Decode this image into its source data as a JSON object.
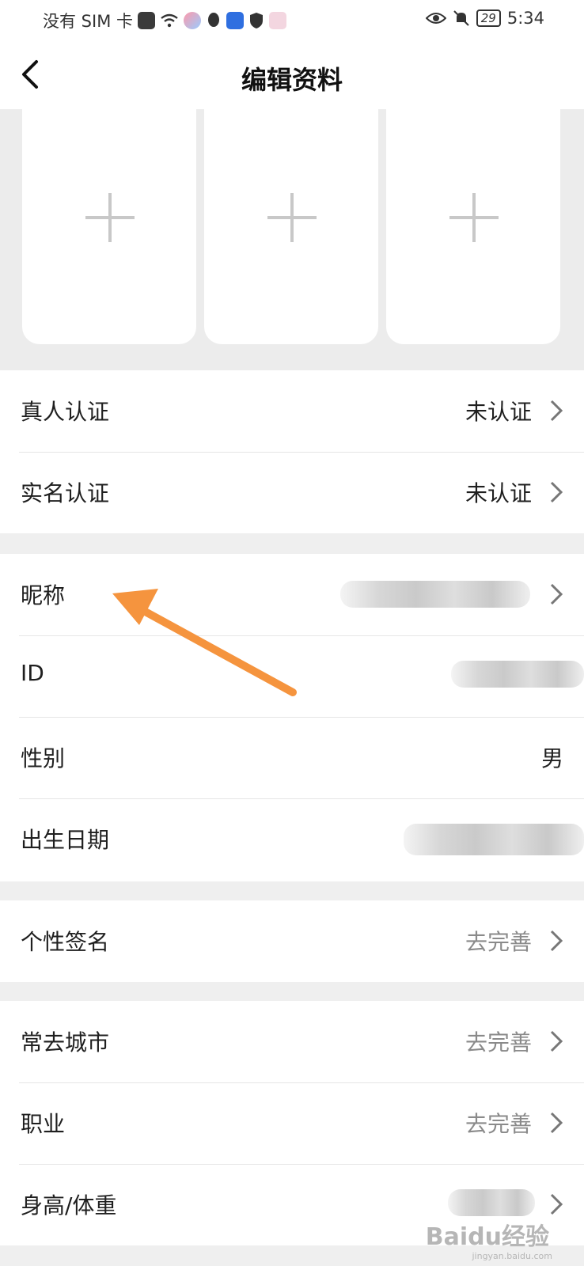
{
  "status_bar": {
    "carrier": "没有 SIM 卡",
    "battery": "29",
    "time": "5:34"
  },
  "header": {
    "title": "编辑资料"
  },
  "verification": [
    {
      "label": "真人认证",
      "value": "未认证"
    },
    {
      "label": "实名认证",
      "value": "未认证"
    }
  ],
  "basic_info": {
    "nickname_label": "昵称",
    "id_label": "ID",
    "gender_label": "性别",
    "gender_value": "男",
    "birthday_label": "出生日期"
  },
  "signature": {
    "label": "个性签名",
    "value": "去完善"
  },
  "extra": [
    {
      "label": "常去城市",
      "value": "去完善"
    },
    {
      "label": "职业",
      "value": "去完善"
    },
    {
      "label": "身高/体重"
    }
  ],
  "watermark": {
    "text": "Baidu经验",
    "sub": "jingyan.baidu.com"
  },
  "colors": {
    "annotation_arrow": "#f5943e",
    "muted_text": "#8a8a8a"
  }
}
